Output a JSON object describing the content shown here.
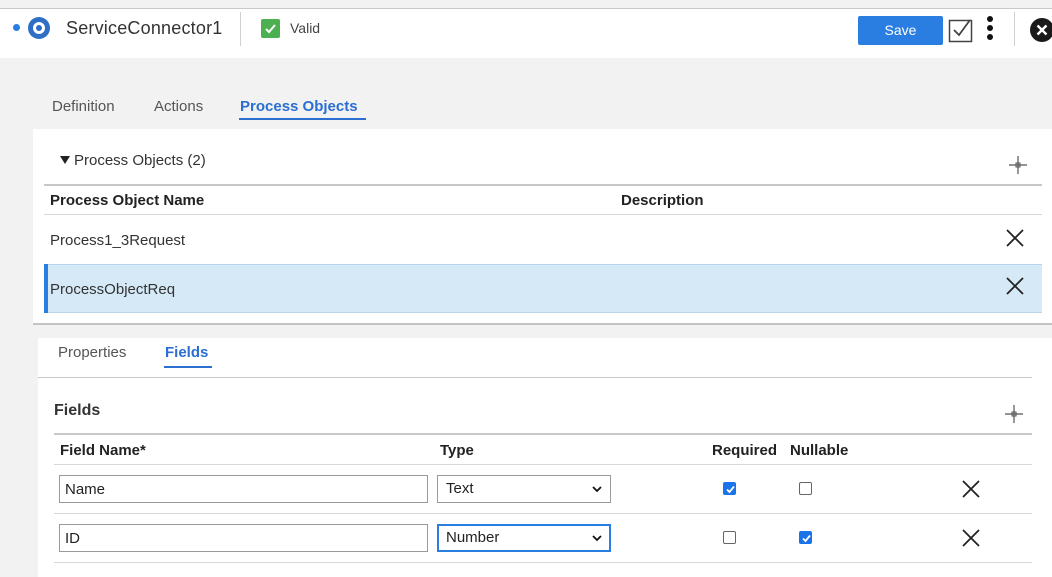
{
  "header": {
    "title": "ServiceConnector1",
    "status": "Valid",
    "save_label": "Save"
  },
  "main_tabs": [
    {
      "label": "Definition",
      "active": false
    },
    {
      "label": "Actions",
      "active": false
    },
    {
      "label": "Process Objects",
      "active": true
    }
  ],
  "process_objects": {
    "section_title": "Process Objects (2)",
    "columns": [
      "Process Object Name",
      "Description"
    ],
    "rows": [
      {
        "name": "Process1_3Request",
        "description": "",
        "selected": false
      },
      {
        "name": "ProcessObjectReq",
        "description": "",
        "selected": true
      }
    ]
  },
  "sub_tabs": [
    {
      "label": "Properties",
      "active": false
    },
    {
      "label": "Fields",
      "active": true
    }
  ],
  "fields": {
    "section_title": "Fields",
    "columns": {
      "field_name": "Field Name*",
      "type": "Type",
      "required": "Required",
      "nullable": "Nullable"
    },
    "rows": [
      {
        "name": "Name",
        "type": "Text",
        "required": true,
        "nullable": false
      },
      {
        "name": "ID",
        "type": "Number",
        "required": false,
        "nullable": true
      }
    ]
  },
  "colors": {
    "accent": "#2a7de1",
    "tab_active": "#2a6fd1",
    "valid": "#4caf50",
    "selected_row": "#d6e9f7"
  },
  "icons": [
    "settings-icon",
    "check-icon",
    "review-icon",
    "kebab-icon",
    "close-circle-icon",
    "caret-down-icon",
    "plus-icon",
    "close-icon",
    "chevron-down-icon"
  ]
}
